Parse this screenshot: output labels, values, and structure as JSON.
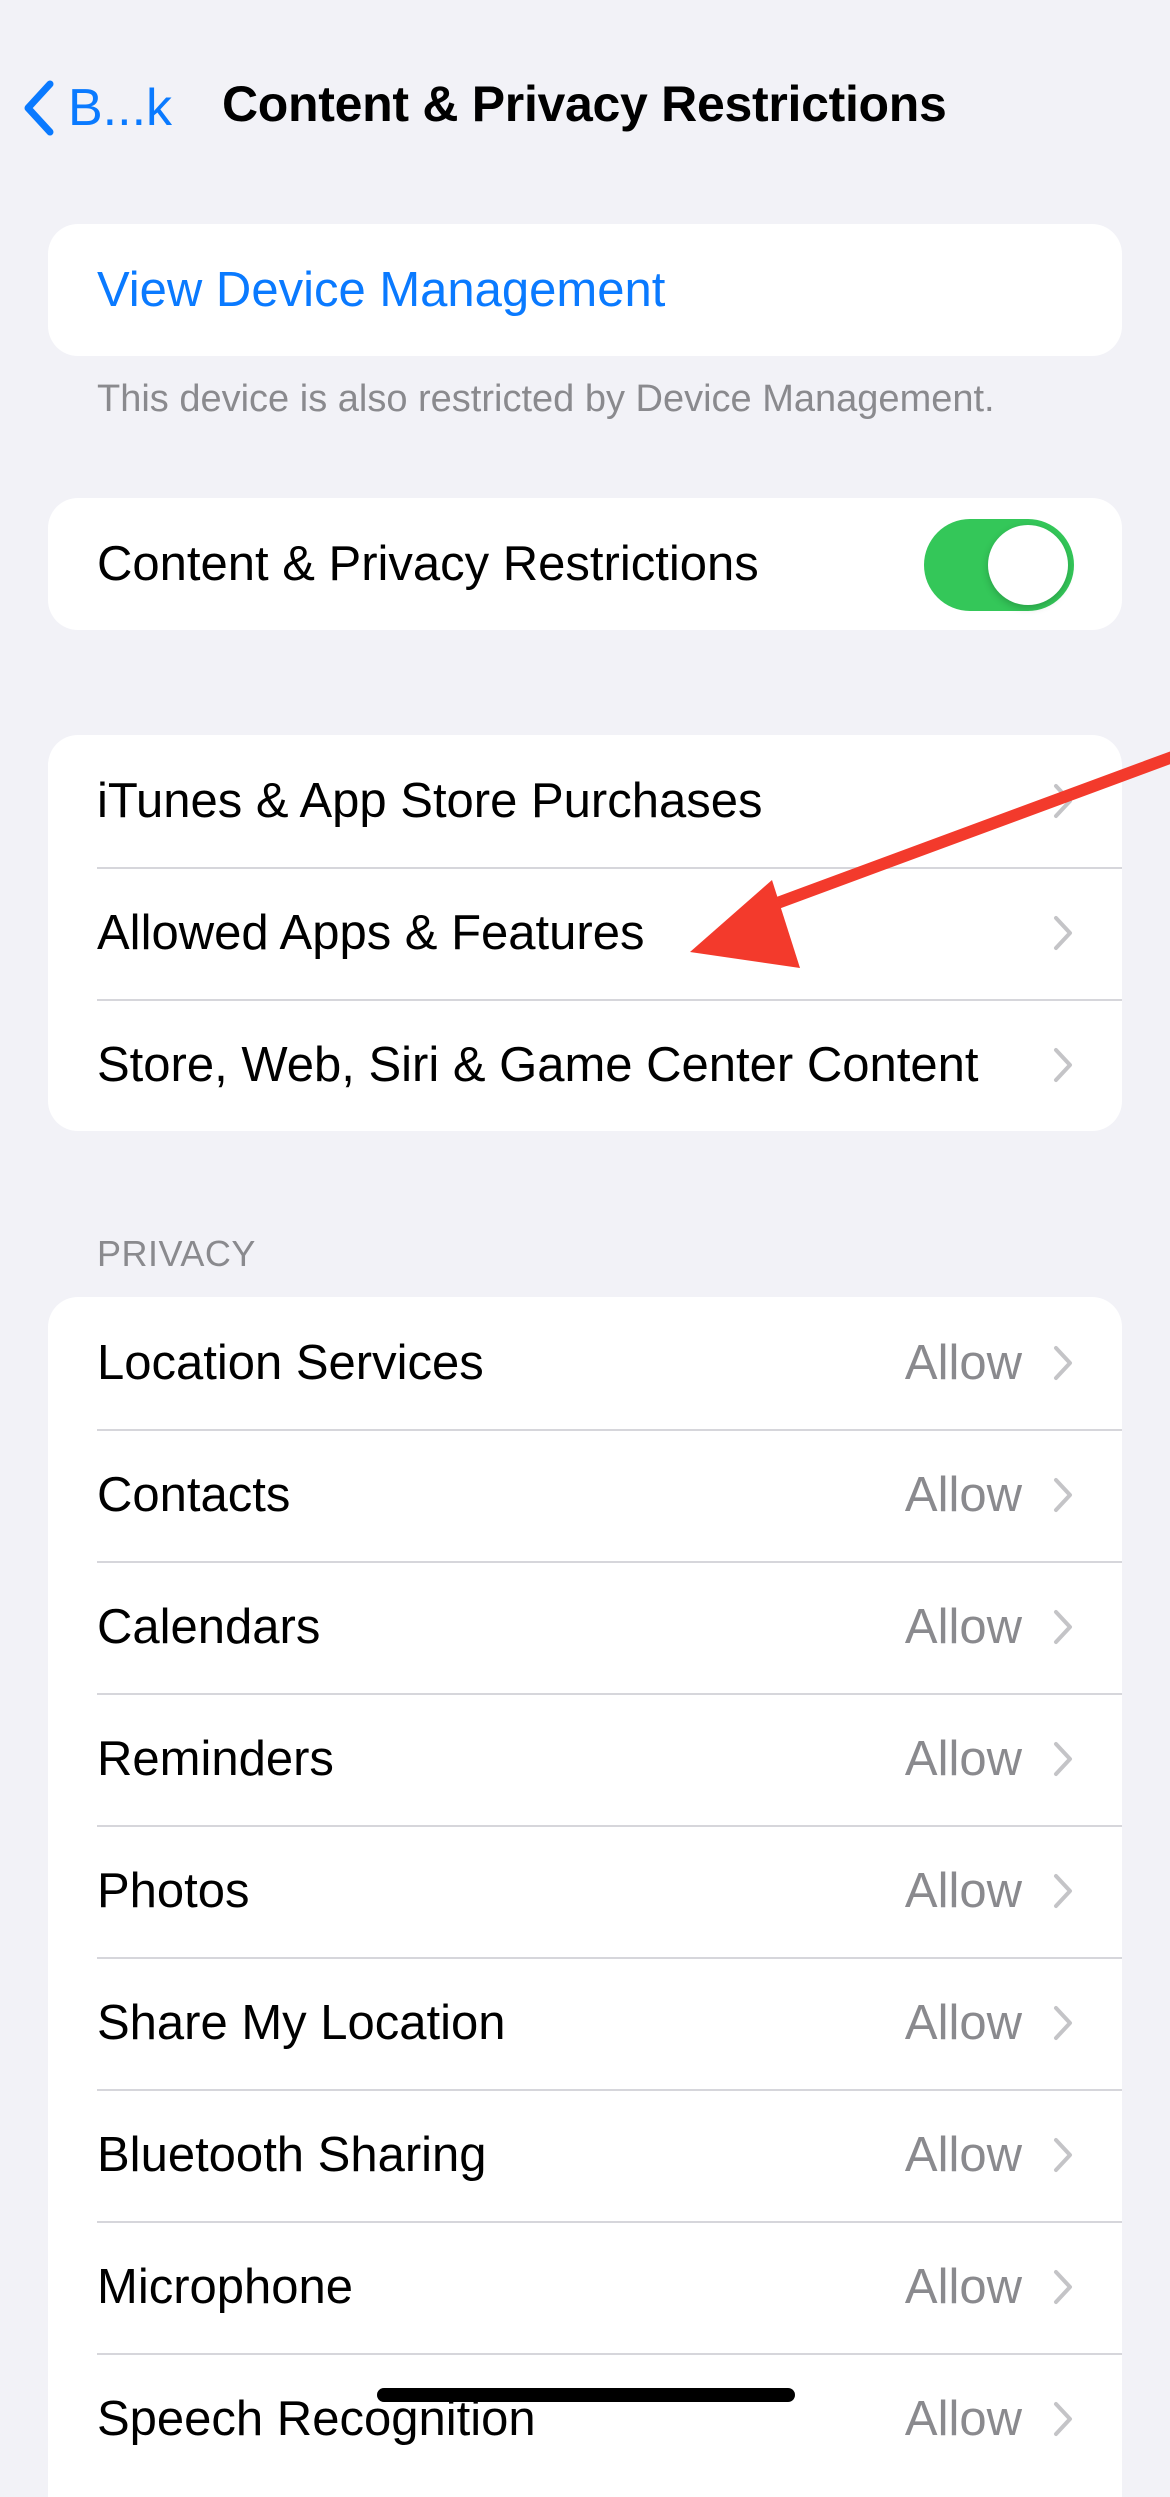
{
  "nav": {
    "back_label": "B...k",
    "title": "Content & Privacy Restrictions"
  },
  "device_management": {
    "link_label": "View Device Management",
    "footer": "This device is also restricted by Device Management."
  },
  "restrictions_toggle": {
    "label": "Content & Privacy Restrictions",
    "on": true
  },
  "content_items": [
    {
      "label": "iTunes & App Store Purchases"
    },
    {
      "label": "Allowed Apps & Features"
    },
    {
      "label": "Store, Web, Siri & Game Center Content"
    }
  ],
  "privacy": {
    "header": "PRIVACY",
    "items": [
      {
        "label": "Location Services",
        "value": "Allow"
      },
      {
        "label": "Contacts",
        "value": "Allow"
      },
      {
        "label": "Calendars",
        "value": "Allow"
      },
      {
        "label": "Reminders",
        "value": "Allow"
      },
      {
        "label": "Photos",
        "value": "Allow"
      },
      {
        "label": "Share My Location",
        "value": "Allow"
      },
      {
        "label": "Bluetooth Sharing",
        "value": "Allow"
      },
      {
        "label": "Microphone",
        "value": "Allow"
      },
      {
        "label": "Speech Recognition",
        "value": "Allow"
      }
    ]
  },
  "colors": {
    "accent": "#0a7aff",
    "toggle_on": "#34c759",
    "annotation": "#f33a2c",
    "background": "#f2f2f7"
  },
  "icons": [
    "chevron-left-icon",
    "chevron-right-icon",
    "red-arrow-annotation"
  ]
}
